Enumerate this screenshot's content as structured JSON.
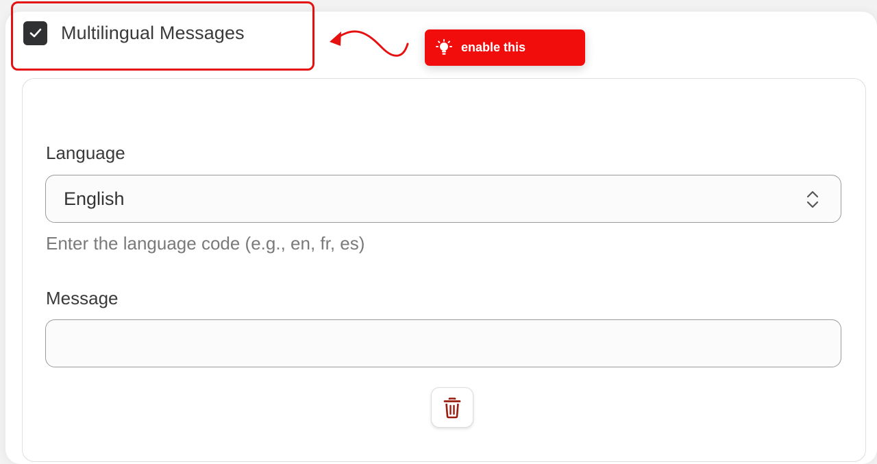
{
  "multilingual": {
    "label": "Multilingual Messages",
    "checked": true
  },
  "callout": {
    "text": "enable this",
    "icon": "lightbulb-icon",
    "color": "#f20d0d"
  },
  "language_field": {
    "label": "Language",
    "value": "English",
    "helper": "Enter the language code (e.g., en, fr, es)"
  },
  "message_field": {
    "label": "Message",
    "value": ""
  },
  "actions": {
    "delete_icon": "trash-icon",
    "delete_color": "#9b1c0f"
  },
  "annotation_color": "#e51111"
}
